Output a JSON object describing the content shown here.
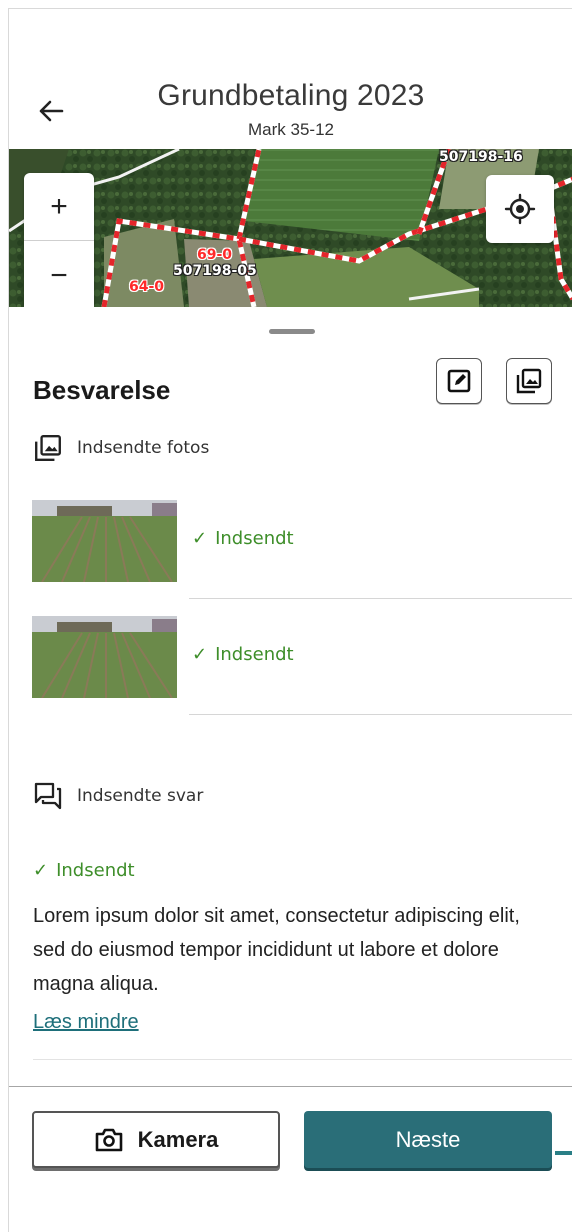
{
  "header": {
    "back_icon": "arrow-left-icon",
    "title": "Grundbetaling 2023",
    "subtitle": "Mark 35-12"
  },
  "map": {
    "zoom_in_label": "+",
    "zoom_out_label": "−",
    "locate_icon": "locate-target-icon",
    "labels": {
      "parcel_1": "507198-16",
      "parcel_2": "507198-05",
      "field_1": "69-0",
      "field_2": "64-0"
    },
    "colors": {
      "boundary_red": "#e4252a",
      "boundary_white": "#ffffff"
    }
  },
  "sheet": {
    "title": "Besvarelse",
    "edit_icon": "edit-icon",
    "gallery_icon": "gallery-icon",
    "photos_section": {
      "icon": "gallery-icon",
      "label": "Indsendte fotos",
      "items": [
        {
          "thumbnail": "field-photo",
          "status": "Indsendt"
        },
        {
          "thumbnail": "field-photo",
          "status": "Indsendt"
        }
      ]
    },
    "answers_section": {
      "icon": "chat-icon",
      "label": "Indsendte svar",
      "status": "Indsendt",
      "text": "Lorem ipsum dolor sit amet, consectetur adipiscing elit, sed do eiusmod tempor incididunt ut labore et dolore magna aliqua.",
      "link": "Læs mindre"
    },
    "colors": {
      "success": "#3e8e2a",
      "link": "#1e6f7a"
    }
  },
  "footer": {
    "camera_label": "Kamera",
    "camera_icon": "camera-icon",
    "next_label": "Næste",
    "colors": {
      "primary": "#2a6e78"
    }
  }
}
